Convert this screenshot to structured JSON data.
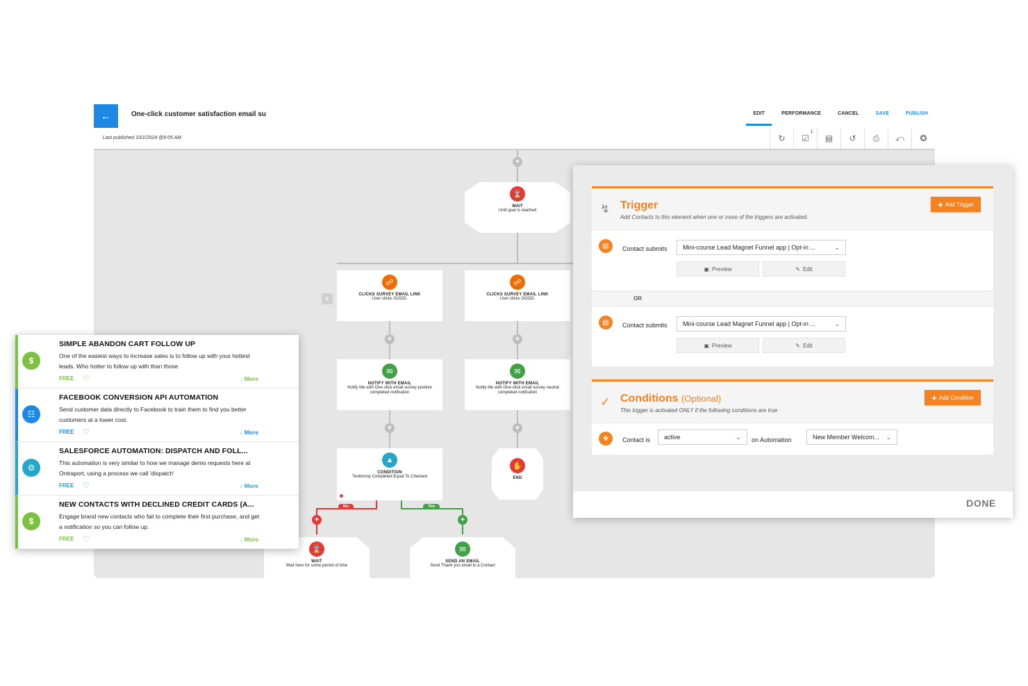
{
  "header": {
    "back_icon": "arrow-left-icon",
    "title": "One-click customer satisfaction email su",
    "published": "Last published 10/1/2024 @9:05 AM",
    "nav": {
      "edit": "EDIT",
      "performance": "PERFORMANCE",
      "cancel": "CANCEL",
      "save": "SAVE",
      "publish": "PUBLISH"
    },
    "toolbar": {
      "tasks_badge": "1"
    }
  },
  "canvas": {
    "wait_top": {
      "title": "WAIT",
      "desc": "Until goal is reached"
    },
    "clicks_left": {
      "title": "CLICKS SURVEY EMAIL LINK",
      "desc": "User clicks GOOD."
    },
    "clicks_right": {
      "title": "CLICKS SURVEY EMAIL LINK",
      "desc": "User clicks GOOD."
    },
    "notify_left": {
      "title": "NOTIFY WITH EMAIL",
      "desc": "Notify Me with One-click email survey positive completed notifcation"
    },
    "notify_right": {
      "title": "NOTIFY WITH EMAIL",
      "desc": "Notify Me with One-click email survey neutral completed notifcation"
    },
    "condition": {
      "title": "CONDITION",
      "desc": "Testimony Completed Equal To Checked"
    },
    "end": {
      "title": "END"
    },
    "branch_no": "No",
    "branch_yes": "Yes",
    "wait_bottom": {
      "title": "WAIT",
      "desc": "Wait here for some period of time"
    },
    "send_email": {
      "title": "SEND AN EMAIL",
      "desc": "Send Thank you email to a Contact"
    }
  },
  "panel": {
    "trigger": {
      "title": "Trigger",
      "subtitle": "Add Contacts to this element when one or more of the triggers are activated.",
      "add_label": "Add Trigger",
      "rows": [
        {
          "label": "Contact submits",
          "value": "Mini-course Lead Magnet Funnel app | Opt-in ...",
          "preview": "Preview",
          "edit": "Edit"
        },
        {
          "label": "Contact submits",
          "value": "Mini-course Lead Magnet Funnel app | Opt-in ...",
          "preview": "Preview",
          "edit": "Edit"
        }
      ],
      "or_label": "OR"
    },
    "conditions": {
      "title": "Conditions",
      "optional": "(Optional)",
      "subtitle": "This trigger is activated ONLY if the following conditions are true",
      "add_label": "Add Condition",
      "row": {
        "label": "Contact is",
        "status": "active",
        "mid": "on Automation",
        "automation": "New Member Welcom..."
      }
    },
    "done": "DONE"
  },
  "recipes": [
    {
      "title": "SIMPLE ABANDON CART FOLLOW UP",
      "desc": "One of the easiest ways to increase sales is to follow up with your hottest leads. Who hotter to follow up with than those",
      "free": "FREE",
      "more": "More",
      "color": "#7cc142",
      "icon": "dollar-truck-icon"
    },
    {
      "title": "FACEBOOK CONVERSION API AUTOMATION",
      "desc": "Send customer data directly to Facebook to train them to find you better customers at a lower cost.",
      "free": "FREE",
      "more": "More",
      "color": "#1e88e5",
      "icon": "org-chart-icon"
    },
    {
      "title": "SALESFORCE AUTOMATION: DISPATCH AND FOLL...",
      "desc": "This automation is very similar to how we manage demo requests here at Ontraport, using a process we call 'dispatch'",
      "free": "FREE",
      "more": "More",
      "color": "#26a6c9",
      "icon": "gears-icon"
    },
    {
      "title": "NEW CONTACTS WITH DECLINED CREDIT CARDS (A...",
      "desc": "Engage brand new contacts who fail to complete their first purchase, and get a notification so you can follow up.",
      "free": "FREE",
      "more": "More",
      "color": "#7cc142",
      "icon": "dollar-truck-icon"
    }
  ]
}
